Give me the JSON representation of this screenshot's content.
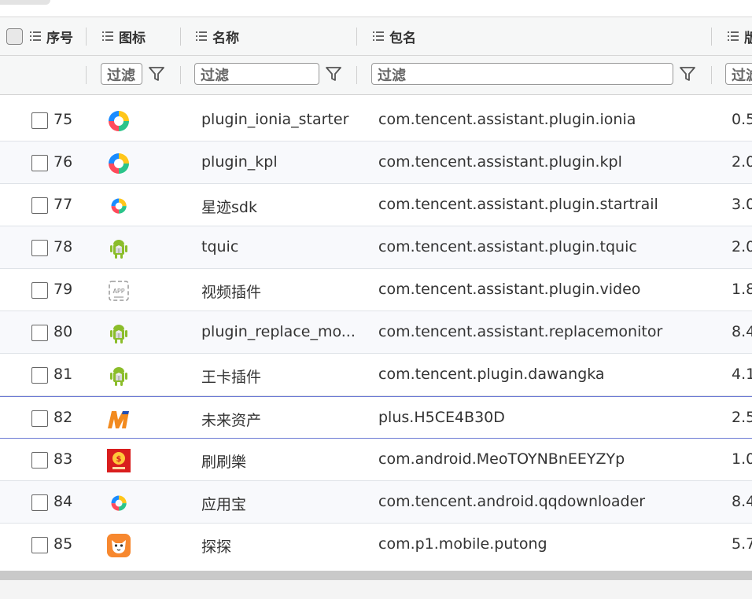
{
  "header": {
    "columns": [
      {
        "label": "序号"
      },
      {
        "label": "图标"
      },
      {
        "label": "名称"
      },
      {
        "label": "包名"
      },
      {
        "label": "版"
      }
    ]
  },
  "filter": {
    "placeholder": "过滤",
    "fields": [
      "过滤",
      "过滤",
      "过滤",
      "过滤"
    ]
  },
  "rows": [
    {
      "num": "75",
      "icon": "yingyongbao-icon",
      "name": "plugin_ionia_starter",
      "package": "com.tencent.assistant.plugin.ionia",
      "version": "0.5"
    },
    {
      "num": "76",
      "icon": "yingyongbao-icon",
      "name": "plugin_kpl",
      "package": "com.tencent.assistant.plugin.kpl",
      "version": "2.0"
    },
    {
      "num": "77",
      "icon": "yingyongbao-icon",
      "name": "星迹sdk",
      "package": "com.tencent.assistant.plugin.startrail",
      "version": "3.0"
    },
    {
      "num": "78",
      "icon": "android-icon",
      "name": "tquic",
      "package": "com.tencent.assistant.plugin.tquic",
      "version": "2.0"
    },
    {
      "num": "79",
      "icon": "app-placeholder-icon",
      "name": "视频插件",
      "package": "com.tencent.assistant.plugin.video",
      "version": "1.8"
    },
    {
      "num": "80",
      "icon": "android-icon",
      "name": "plugin_replace_mo...",
      "package": "com.tencent.assistant.replacemonitor",
      "version": "8.4"
    },
    {
      "num": "81",
      "icon": "android-icon",
      "name": "王卡插件",
      "package": "com.tencent.plugin.dawangka",
      "version": "4.1"
    },
    {
      "num": "82",
      "icon": "m-logo-icon",
      "name": "未来资产",
      "package": "plus.H5CE4B30D",
      "version": "2.5"
    },
    {
      "num": "83",
      "icon": "red-coin-app-icon",
      "name": "刷刷樂",
      "package": "com.android.MeoTOYNBnEEYZYp",
      "version": "1.0"
    },
    {
      "num": "84",
      "icon": "yingyongbao-icon",
      "name": "应用宝",
      "package": "com.tencent.android.qqdownloader",
      "version": "8.4"
    },
    {
      "num": "85",
      "icon": "fox-app-icon",
      "name": "探探",
      "package": "com.p1.mobile.putong",
      "version": "5.7"
    }
  ],
  "colors": {
    "selected_border": "#6c7ad4",
    "android_green": "#8bbd2a",
    "m_orange": "#f28a1e",
    "m_blue": "#1f4fb7",
    "red_app": "#d91e1e",
    "fox_orange": "#f7882f"
  }
}
